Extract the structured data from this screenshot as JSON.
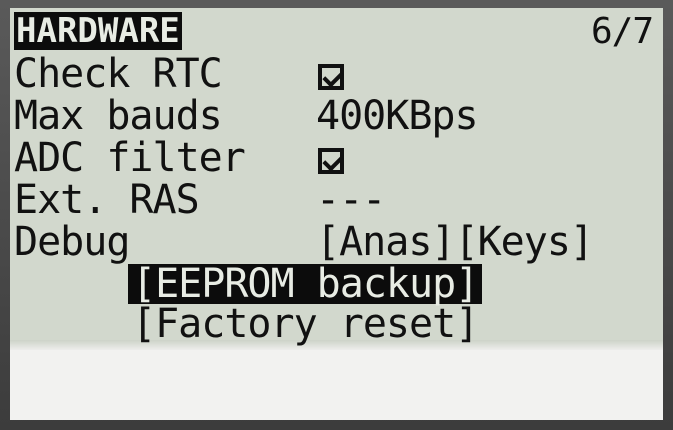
{
  "header": {
    "title": "HARDWARE",
    "page_indicator": "6/7"
  },
  "rows": {
    "check_rtc": {
      "label": "Check RTC",
      "checked": true
    },
    "max_bauds": {
      "label": "Max bauds",
      "value": "400KBps"
    },
    "adc_filter": {
      "label": "ADC filter",
      "checked": true
    },
    "ext_ras": {
      "label": "Ext. RAS",
      "value": "---"
    },
    "debug": {
      "label": "Debug",
      "value": "[Anas][Keys]"
    }
  },
  "buttons": {
    "eeprom_backup": "[EEPROM backup]",
    "factory_reset": "[Factory reset]"
  },
  "colors": {
    "lcd_background": "#d2d8cd",
    "text": "#111111",
    "bezel": "#4a4a4a"
  }
}
